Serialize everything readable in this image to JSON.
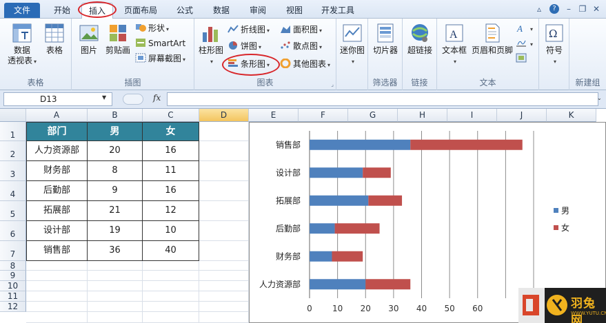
{
  "tabs": {
    "file": "文件",
    "home": "开始",
    "insert": "插入",
    "layout": "页面布局",
    "formulas": "公式",
    "data": "数据",
    "review": "审阅",
    "view": "视图",
    "developer": "开发工具"
  },
  "ribbon": {
    "tables": {
      "pivot_line1": "数据",
      "pivot_line2": "透视表",
      "table": "表格",
      "label": "表格"
    },
    "illustrations": {
      "picture": "图片",
      "clipart": "剪贴画",
      "shapes": "形状",
      "smartart": "SmartArt",
      "screenshot": "屏幕截图",
      "label": "插图"
    },
    "charts": {
      "column": "柱形图",
      "line": "折线图",
      "pie": "饼图",
      "bar": "条形图",
      "area": "面积图",
      "scatter": "散点图",
      "other": "其他图表",
      "label": "图表"
    },
    "sparklines": {
      "sparkline": "迷你图"
    },
    "filter": {
      "slicer": "切片器",
      "label": "筛选器"
    },
    "links": {
      "hyperlink": "超链接",
      "label": "链接"
    },
    "text": {
      "textbox": "文本框",
      "headerfooter": "页眉和页脚",
      "label": "文本"
    },
    "symbols": {
      "symbol": "符号"
    },
    "newgroup": {
      "label": "新建组"
    }
  },
  "formula_bar": {
    "name_box": "D13",
    "fx": "fx",
    "value": ""
  },
  "columns": [
    "A",
    "B",
    "C",
    "D",
    "E",
    "F",
    "G",
    "H",
    "I",
    "J",
    "K"
  ],
  "rows": [
    "1",
    "2",
    "3",
    "4",
    "5",
    "6",
    "7",
    "8",
    "9",
    "10",
    "11",
    "12"
  ],
  "table": {
    "headers": [
      "部门",
      "男",
      "女"
    ],
    "rows": [
      [
        "人力资源部",
        "20",
        "16"
      ],
      [
        "财务部",
        "8",
        "11"
      ],
      [
        "后勤部",
        "9",
        "16"
      ],
      [
        "拓展部",
        "21",
        "12"
      ],
      [
        "设计部",
        "19",
        "10"
      ],
      [
        "销售部",
        "36",
        "40"
      ]
    ]
  },
  "chart_data": {
    "type": "bar",
    "stacked": true,
    "categories": [
      "人力资源部",
      "财务部",
      "后勤部",
      "拓展部",
      "设计部",
      "销售部"
    ],
    "series": [
      {
        "name": "男",
        "values": [
          20,
          8,
          9,
          21,
          19,
          36
        ],
        "color": "#4f81bd"
      },
      {
        "name": "女",
        "values": [
          16,
          11,
          16,
          12,
          10,
          40
        ],
        "color": "#c0504d"
      }
    ],
    "xlim": [
      0,
      80
    ],
    "xticks": [
      "0",
      "10",
      "20",
      "30",
      "40",
      "50",
      "60"
    ],
    "grid": true,
    "legend": "right"
  },
  "watermark": {
    "brand": "羽兔网",
    "url": "WWW.YUTU.CN"
  },
  "colors": {
    "header_fill": "#31849b",
    "file_tab": "#2b6bb6",
    "highlight": "#d8262a",
    "male": "#4f81bd",
    "female": "#c0504d"
  }
}
